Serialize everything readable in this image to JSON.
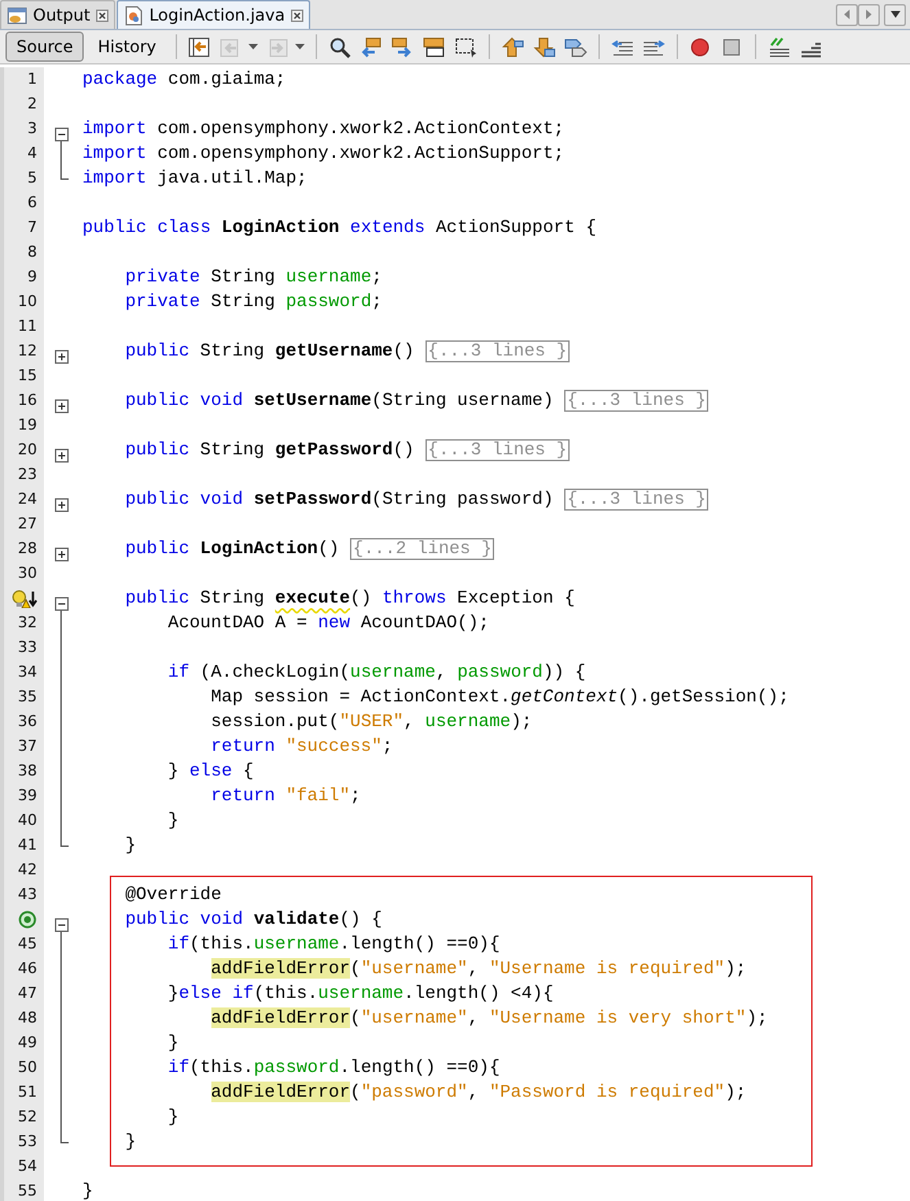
{
  "tabs": [
    {
      "label": "Output",
      "kind": "console",
      "selected": false
    },
    {
      "label": "LoginAction.java",
      "kind": "java",
      "selected": true
    }
  ],
  "views": [
    {
      "label": "Source",
      "selected": true
    },
    {
      "label": "History",
      "selected": false
    }
  ],
  "toolbar_groups": [
    [
      {
        "kind": "last-edit",
        "disabled": false,
        "dropdown": false
      },
      {
        "kind": "back",
        "disabled": true,
        "dropdown": true
      },
      {
        "kind": "forward",
        "disabled": true,
        "dropdown": true
      }
    ],
    [
      {
        "kind": "find",
        "disabled": false
      },
      {
        "kind": "find-previous",
        "disabled": false
      },
      {
        "kind": "find-next",
        "disabled": false
      },
      {
        "kind": "highlight",
        "disabled": false
      },
      {
        "kind": "rect-select",
        "disabled": false
      }
    ],
    [
      {
        "kind": "prev-bookmark",
        "disabled": false
      },
      {
        "kind": "next-bookmark",
        "disabled": false
      },
      {
        "kind": "toggle-bookmark",
        "disabled": false
      }
    ],
    [
      {
        "kind": "shift-left",
        "disabled": false
      },
      {
        "kind": "shift-right",
        "disabled": false
      }
    ],
    [
      {
        "kind": "record",
        "disabled": false
      },
      {
        "kind": "stop",
        "disabled": false
      }
    ],
    [
      {
        "kind": "comment",
        "disabled": false
      },
      {
        "kind": "uncomment",
        "disabled": false
      }
    ]
  ],
  "lines": [
    {
      "number": "1",
      "kind": "code",
      "tokens": [
        {
          "kind": "keyword",
          "text": "package"
        },
        {
          "kind": "plain",
          "text": " com.giaima;"
        }
      ]
    },
    {
      "number": "2",
      "kind": "code"
    },
    {
      "number": "3",
      "kind": "fold-start",
      "tokens": [
        {
          "kind": "keyword",
          "text": "import"
        },
        {
          "kind": "plain",
          "text": " com.opensymphony.xwork2.ActionContext;"
        }
      ]
    },
    {
      "number": "4",
      "kind": "fold-body",
      "tokens": [
        {
          "kind": "keyword",
          "text": "import"
        },
        {
          "kind": "plain",
          "text": " com.opensymphony.xwork2.ActionSupport;"
        }
      ]
    },
    {
      "number": "5",
      "kind": "fold-end",
      "tokens": [
        {
          "kind": "keyword",
          "text": "import"
        },
        {
          "kind": "plain",
          "text": " java.util.Map;"
        }
      ]
    },
    {
      "number": "6",
      "kind": "code"
    },
    {
      "number": "7",
      "kind": "code",
      "tokens": [
        {
          "kind": "keyword",
          "text": "public class "
        },
        {
          "kind": "declaration",
          "text": "LoginAction"
        },
        {
          "kind": "keyword",
          "text": " extends"
        },
        {
          "kind": "plain",
          "text": " ActionSupport {"
        }
      ],
      "children": [
        {
          "number": "8",
          "kind": "code"
        },
        {
          "number": "9",
          "kind": "code",
          "tokens": [
            {
              "kind": "keyword",
              "text": "private"
            },
            {
              "kind": "plain",
              "text": " String "
            },
            {
              "kind": "field",
              "text": "username"
            },
            {
              "kind": "plain",
              "text": ";"
            }
          ]
        },
        {
          "number": "10",
          "kind": "code",
          "tokens": [
            {
              "kind": "keyword",
              "text": "private"
            },
            {
              "kind": "plain",
              "text": " String "
            },
            {
              "kind": "field",
              "text": "password"
            },
            {
              "kind": "plain",
              "text": ";"
            }
          ]
        },
        {
          "number": "11",
          "kind": "code"
        },
        {
          "number": "12",
          "kind": "folded",
          "tokens": [
            {
              "kind": "keyword",
              "text": "public"
            },
            {
              "kind": "plain",
              "text": " String "
            },
            {
              "kind": "declaration",
              "text": "getUsername"
            },
            {
              "kind": "plain",
              "text": "()"
            }
          ],
          "folded": "{...3 lines }"
        },
        {
          "number": "15",
          "kind": "code"
        },
        {
          "number": "16",
          "kind": "folded",
          "tokens": [
            {
              "kind": "keyword",
              "text": "public void "
            },
            {
              "kind": "declaration",
              "text": "setUsername"
            },
            {
              "kind": "plain",
              "text": "(String username)"
            }
          ],
          "folded": "{...3 lines }"
        },
        {
          "number": "19",
          "kind": "code"
        },
        {
          "number": "20",
          "kind": "folded",
          "tokens": [
            {
              "kind": "keyword",
              "text": "public"
            },
            {
              "kind": "plain",
              "text": " String "
            },
            {
              "kind": "declaration",
              "text": "getPassword"
            },
            {
              "kind": "plain",
              "text": "()"
            }
          ],
          "folded": "{...3 lines }"
        },
        {
          "number": "23",
          "kind": "code"
        },
        {
          "number": "24",
          "kind": "folded",
          "tokens": [
            {
              "kind": "keyword",
              "text": "public void "
            },
            {
              "kind": "declaration",
              "text": "setPassword"
            },
            {
              "kind": "plain",
              "text": "(String password)"
            }
          ],
          "folded": "{...3 lines }"
        },
        {
          "number": "27",
          "kind": "code"
        },
        {
          "number": "28",
          "kind": "folded",
          "tokens": [
            {
              "kind": "keyword",
              "text": "public "
            },
            {
              "kind": "declaration",
              "text": "LoginAction"
            },
            {
              "kind": "plain",
              "text": "()"
            }
          ],
          "folded": "{...2 lines }"
        },
        {
          "number": "30",
          "kind": "code"
        },
        {
          "marker": {
            "kind": "hint-warning"
          },
          "kind": "fold-start",
          "tokens": [
            {
              "kind": "keyword",
              "text": "public"
            },
            {
              "kind": "plain",
              "text": " String "
            },
            {
              "kind": "declaration-warning",
              "text": "execute"
            },
            {
              "kind": "plain",
              "text": "() "
            },
            {
              "kind": "keyword",
              "text": "throws"
            },
            {
              "kind": "plain",
              "text": " Exception {"
            }
          ],
          "children": [
            {
              "number": "32",
              "kind": "fold-body",
              "tokens": [
                {
                  "kind": "plain",
                  "text": "AcountDAO A = "
                },
                {
                  "kind": "keyword",
                  "text": "new"
                },
                {
                  "kind": "plain",
                  "text": " AcountDAO();"
                }
              ]
            },
            {
              "number": "33",
              "kind": "fold-body"
            },
            {
              "number": "34",
              "kind": "fold-body",
              "tokens": [
                {
                  "kind": "keyword",
                  "text": "if"
                },
                {
                  "kind": "plain",
                  "text": " (A.checkLogin("
                },
                {
                  "kind": "field",
                  "text": "username"
                },
                {
                  "kind": "plain",
                  "text": ", "
                },
                {
                  "kind": "field",
                  "text": "password"
                },
                {
                  "kind": "plain",
                  "text": ")) {"
                }
              ],
              "children": [
                {
                  "number": "35",
                  "kind": "fold-body",
                  "tokens": [
                    {
                      "kind": "plain",
                      "text": "Map session = ActionContext."
                    },
                    {
                      "kind": "static-call",
                      "text": "getContext"
                    },
                    {
                      "kind": "plain",
                      "text": "().getSession();"
                    }
                  ]
                },
                {
                  "number": "36",
                  "kind": "fold-body",
                  "tokens": [
                    {
                      "kind": "plain",
                      "text": "session.put("
                    },
                    {
                      "kind": "string",
                      "text": "\"USER\""
                    },
                    {
                      "kind": "plain",
                      "text": ", "
                    },
                    {
                      "kind": "field",
                      "text": "username"
                    },
                    {
                      "kind": "plain",
                      "text": ");"
                    }
                  ]
                },
                {
                  "number": "37",
                  "kind": "fold-body",
                  "tokens": [
                    {
                      "kind": "keyword",
                      "text": "return "
                    },
                    {
                      "kind": "string",
                      "text": "\"success\""
                    },
                    {
                      "kind": "plain",
                      "text": ";"
                    }
                  ]
                }
              ]
            },
            {
              "number": "38",
              "kind": "fold-body",
              "tokens": [
                {
                  "kind": "plain",
                  "text": "} "
                },
                {
                  "kind": "keyword",
                  "text": "else"
                },
                {
                  "kind": "plain",
                  "text": " {"
                }
              ],
              "children": [
                {
                  "number": "39",
                  "kind": "fold-body",
                  "tokens": [
                    {
                      "kind": "keyword",
                      "text": "return "
                    },
                    {
                      "kind": "string",
                      "text": "\"fail\""
                    },
                    {
                      "kind": "plain",
                      "text": ";"
                    }
                  ]
                }
              ]
            },
            {
              "number": "40",
              "kind": "fold-body",
              "tokens": [
                {
                  "kind": "plain",
                  "text": "}"
                }
              ]
            }
          ]
        },
        {
          "number": "41",
          "kind": "fold-end",
          "tokens": [
            {
              "kind": "plain",
              "text": "}"
            }
          ]
        },
        {
          "number": "42",
          "kind": "code"
        },
        {
          "kind": "highlight-frame",
          "children": [
            {
              "number": "43",
              "kind": "code",
              "tokens": [
                {
                  "kind": "plain",
                  "text": "@Override"
                }
              ]
            },
            {
              "marker": {
                "kind": "override"
              },
              "kind": "fold-start",
              "tokens": [
                {
                  "kind": "keyword",
                  "text": "public void "
                },
                {
                  "kind": "declaration",
                  "text": "validate"
                },
                {
                  "kind": "plain",
                  "text": "() {"
                }
              ],
              "children": [
                {
                  "number": "45",
                  "kind": "fold-body",
                  "tokens": [
                    {
                      "kind": "keyword",
                      "text": "if"
                    },
                    {
                      "kind": "plain",
                      "text": "(this."
                    },
                    {
                      "kind": "field",
                      "text": "username"
                    },
                    {
                      "kind": "plain",
                      "text": ".length() ==0){"
                    }
                  ],
                  "children": [
                    {
                      "number": "46",
                      "kind": "fold-body",
                      "tokens": [
                        {
                          "kind": "highlighted-call",
                          "text": "addFieldError"
                        },
                        {
                          "kind": "plain",
                          "text": "("
                        },
                        {
                          "kind": "string",
                          "text": "\"username\""
                        },
                        {
                          "kind": "plain",
                          "text": ", "
                        },
                        {
                          "kind": "string",
                          "text": "\"Username is required\""
                        },
                        {
                          "kind": "plain",
                          "text": ");"
                        }
                      ]
                    }
                  ]
                },
                {
                  "number": "47",
                  "kind": "fold-body",
                  "tokens": [
                    {
                      "kind": "plain",
                      "text": "}"
                    },
                    {
                      "kind": "keyword",
                      "text": "else if"
                    },
                    {
                      "kind": "plain",
                      "text": "(this."
                    },
                    {
                      "kind": "field",
                      "text": "username"
                    },
                    {
                      "kind": "plain",
                      "text": ".length() <4){"
                    }
                  ],
                  "children": [
                    {
                      "number": "48",
                      "kind": "fold-body",
                      "tokens": [
                        {
                          "kind": "highlighted-call",
                          "text": "addFieldError"
                        },
                        {
                          "kind": "plain",
                          "text": "("
                        },
                        {
                          "kind": "string",
                          "text": "\"username\""
                        },
                        {
                          "kind": "plain",
                          "text": ", "
                        },
                        {
                          "kind": "string",
                          "text": "\"Username is very short\""
                        },
                        {
                          "kind": "plain",
                          "text": ");"
                        }
                      ]
                    }
                  ]
                },
                {
                  "number": "49",
                  "kind": "fold-body",
                  "tokens": [
                    {
                      "kind": "plain",
                      "text": "}"
                    }
                  ]
                },
                {
                  "number": "50",
                  "kind": "fold-body",
                  "tokens": [
                    {
                      "kind": "keyword",
                      "text": "if"
                    },
                    {
                      "kind": "plain",
                      "text": "(this."
                    },
                    {
                      "kind": "field",
                      "text": "password"
                    },
                    {
                      "kind": "plain",
                      "text": ".length() ==0){"
                    }
                  ],
                  "children": [
                    {
                      "number": "51",
                      "kind": "fold-body",
                      "tokens": [
                        {
                          "kind": "highlighted-call",
                          "text": "addFieldError"
                        },
                        {
                          "kind": "plain",
                          "text": "("
                        },
                        {
                          "kind": "string",
                          "text": "\"password\""
                        },
                        {
                          "kind": "plain",
                          "text": ", "
                        },
                        {
                          "kind": "string",
                          "text": "\"Password is required\""
                        },
                        {
                          "kind": "plain",
                          "text": ");"
                        }
                      ]
                    }
                  ]
                },
                {
                  "number": "52",
                  "kind": "fold-body",
                  "tokens": [
                    {
                      "kind": "plain",
                      "text": "}"
                    }
                  ]
                }
              ]
            },
            {
              "number": "53",
              "kind": "fold-end",
              "tokens": [
                {
                  "kind": "plain",
                  "text": "}"
                }
              ]
            }
          ]
        },
        {
          "number": "54",
          "kind": "code"
        }
      ]
    },
    {
      "number": "55",
      "kind": "code",
      "tokens": [
        {
          "kind": "plain",
          "text": "}"
        }
      ]
    }
  ]
}
